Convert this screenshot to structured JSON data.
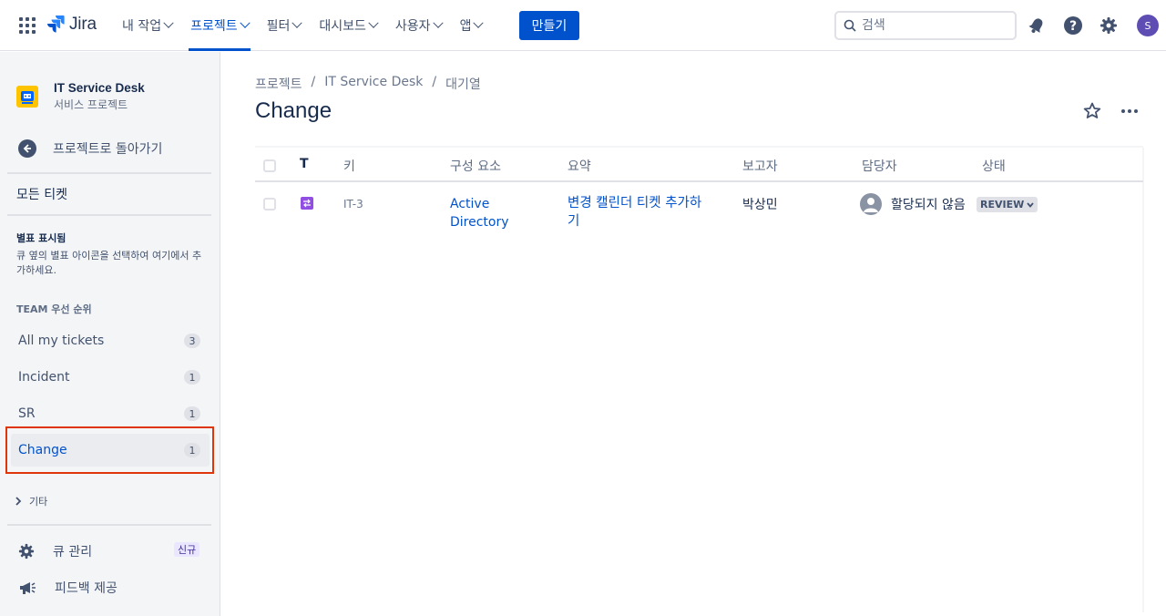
{
  "topnav": {
    "logo_text": "Jira",
    "menu": [
      {
        "label": "내 작업",
        "active": false
      },
      {
        "label": "프로젝트",
        "active": true
      },
      {
        "label": "필터",
        "active": false
      },
      {
        "label": "대시보드",
        "active": false
      },
      {
        "label": "사용자",
        "active": false
      },
      {
        "label": "앱",
        "active": false
      }
    ],
    "create_label": "만들기",
    "search_placeholder": "검색",
    "avatar_initial": "S",
    "brand_color": "#0052cc"
  },
  "sidebar": {
    "project_name": "IT Service Desk",
    "project_type": "서비스 프로젝트",
    "back_label": "프로젝트로 돌아가기",
    "all_tickets": "모든 티켓",
    "starred_heading": "별표 표시됨",
    "starred_desc": "큐 옆의 별표 아이콘을 선택하여 여기에서 추가하세요.",
    "team_heading": "TEAM 우선 순위",
    "queues": [
      {
        "label": "All my tickets",
        "count": "3"
      },
      {
        "label": "Incident",
        "count": "1"
      },
      {
        "label": "SR",
        "count": "1"
      },
      {
        "label": "Change",
        "count": "1"
      }
    ],
    "other_label": "기타",
    "manage_queues": "큐 관리",
    "new_badge": "신규",
    "feedback": "피드백 제공"
  },
  "main": {
    "breadcrumb": [
      "프로젝트",
      "/",
      "IT Service Desk",
      "/",
      "대기열"
    ],
    "title": "Change",
    "columns": {
      "type": "T",
      "key": "키",
      "component": "구성 요소",
      "summary": "요약",
      "reporter": "보고자",
      "assignee": "담당자",
      "status": "상태"
    },
    "rows": [
      {
        "key": "IT-3",
        "component_line1": "Active",
        "component_line2": "Directory",
        "summary_line1": "변경 캘린더 티켓 추가하",
        "summary_line2": "기",
        "reporter": "박상민",
        "assignee": "할당되지 않음",
        "status": "REVIEW"
      }
    ]
  }
}
